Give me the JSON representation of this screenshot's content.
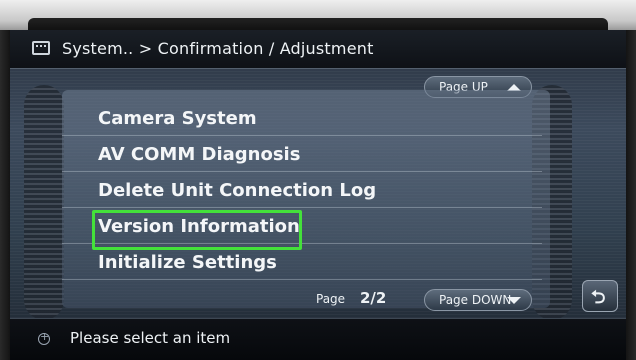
{
  "header": {
    "title": "System.. > Confirmation / Adjustment"
  },
  "nav": {
    "page_up": "Page UP",
    "page_down": "Page DOWN",
    "page_label": "Page",
    "page_number": "2/2"
  },
  "list": {
    "items": [
      {
        "label": "Camera System"
      },
      {
        "label": "AV COMM Diagnosis"
      },
      {
        "label": "Delete Unit Connection Log"
      },
      {
        "label": "Version Information"
      },
      {
        "label": "Initialize Settings"
      }
    ]
  },
  "status": {
    "message": "Please select an item"
  },
  "colors": {
    "highlight": "#44e13a",
    "text": "#eef2f5"
  }
}
